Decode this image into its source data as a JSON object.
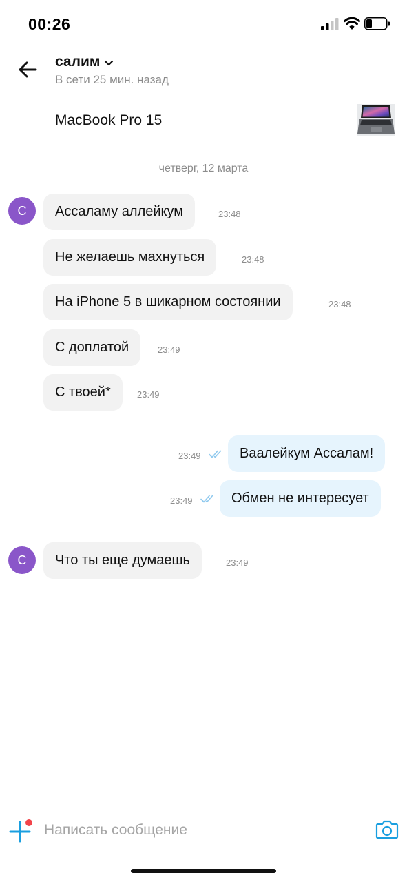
{
  "status_bar": {
    "time": "00:26"
  },
  "header": {
    "contact_name": "салим",
    "contact_status": "В сети 25 мин. назад"
  },
  "product": {
    "title": "MacBook Pro 15"
  },
  "chat": {
    "date": "четверг, 12 марта",
    "avatar_letter": "С",
    "messages": [
      {
        "text": "Ассаламу аллейкум",
        "time": "23:48"
      },
      {
        "text": "Не желаешь махнуться",
        "time": "23:48"
      },
      {
        "text": "На iPhone 5 в шикарном состоянии",
        "time": "23:48"
      },
      {
        "text": "С доплатой",
        "time": "23:49"
      },
      {
        "text": "С твоей*",
        "time": "23:49"
      },
      {
        "text": "Ваалейкум Ассалам!",
        "time": "23:49"
      },
      {
        "text": "Обмен не интересует",
        "time": "23:49"
      },
      {
        "text": "Что ты еще думаешь",
        "time": "23:49"
      }
    ]
  },
  "composer": {
    "placeholder": "Написать сообщение"
  },
  "colors": {
    "accent": "#1a9fe0",
    "avatar": "#8a56c9",
    "incoming_bubble": "#f2f2f2",
    "outgoing_bubble": "#e6f4fd",
    "notification_dot": "#f2444a"
  }
}
